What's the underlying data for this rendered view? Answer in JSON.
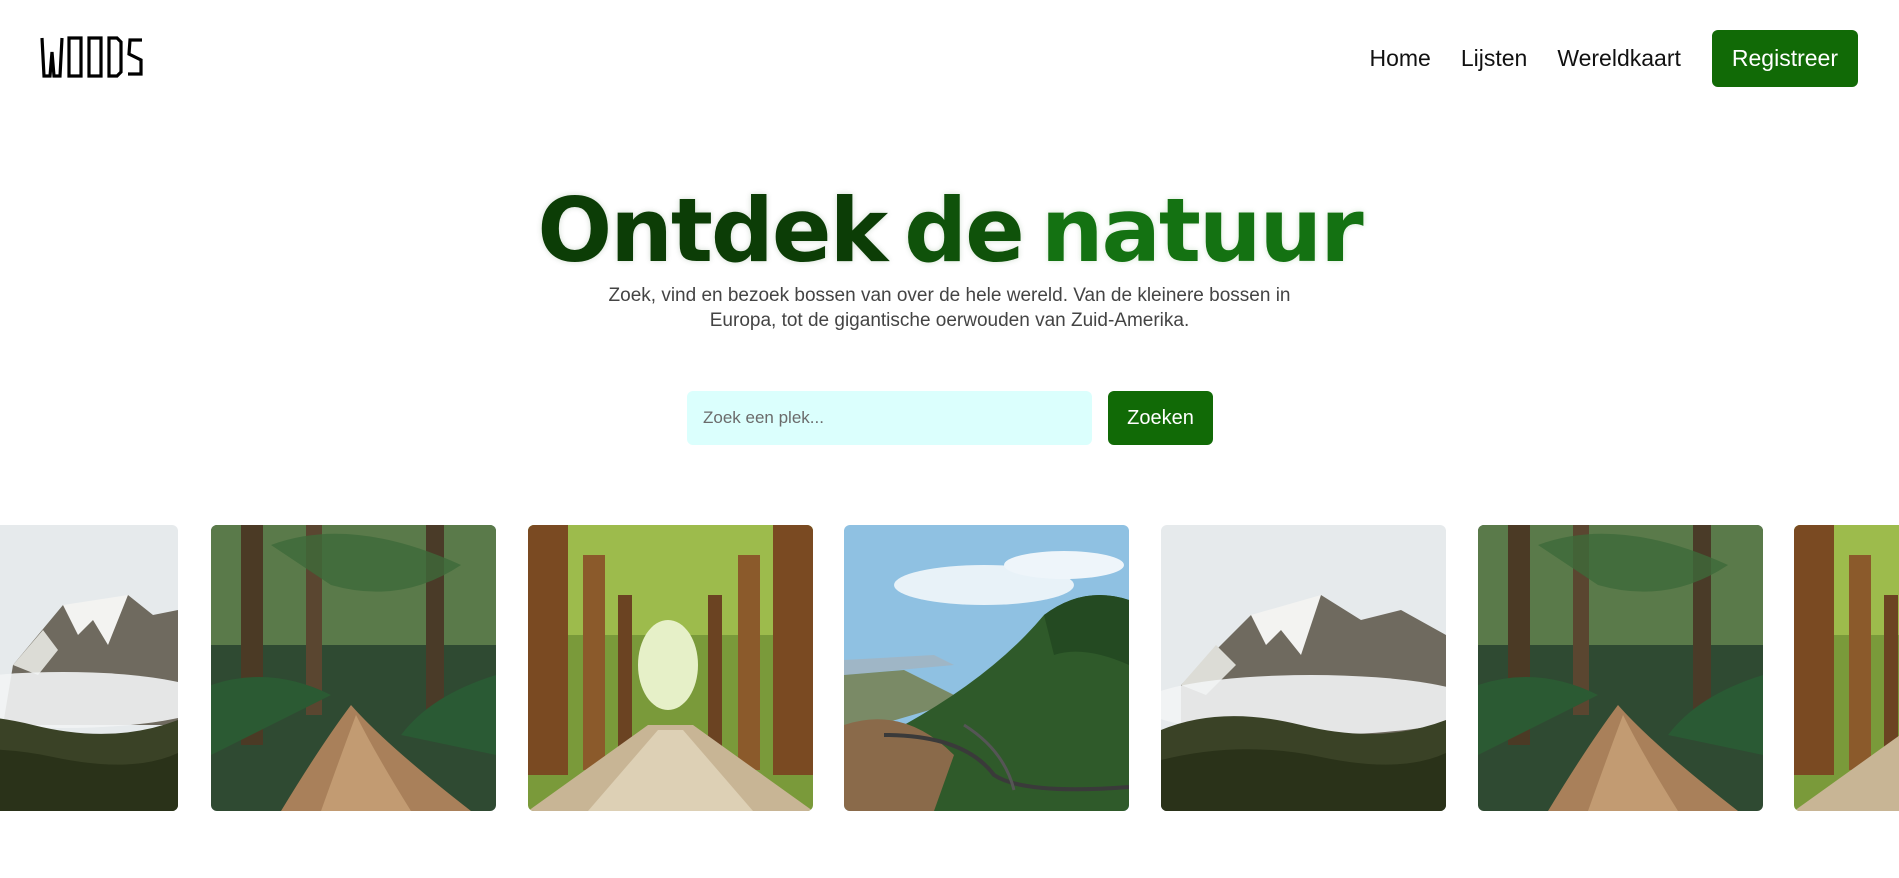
{
  "brand": {
    "logo_text": "WOODS"
  },
  "nav": {
    "items": [
      "Home",
      "Lijsten",
      "Wereldkaart"
    ],
    "register_label": "Registreer"
  },
  "hero": {
    "title_words": [
      "Ontdek",
      "de",
      "natuur"
    ],
    "subtitle_lines": [
      "Zoek, vind en bezoek bossen van over de hele wereld. Van de kleinere bossen in",
      "Europa, tot de gigantische oerwouden van Zuid-Amerika."
    ]
  },
  "search": {
    "placeholder": "Zoek een plek...",
    "value": "",
    "button_label": "Zoeken"
  },
  "gallery": {
    "tiles": [
      "misty-mountain-photo",
      "jungle-path-photo",
      "forest-avenue-photo",
      "valley-road-photo",
      "misty-mountain-photo",
      "jungle-path-photo",
      "forest-avenue-photo"
    ]
  },
  "colors": {
    "accent": "#116a06",
    "search_bg": "#dbfffd",
    "title_dark": "#0c3d06",
    "title_mid": "#0f520a",
    "title_light": "#147212"
  }
}
